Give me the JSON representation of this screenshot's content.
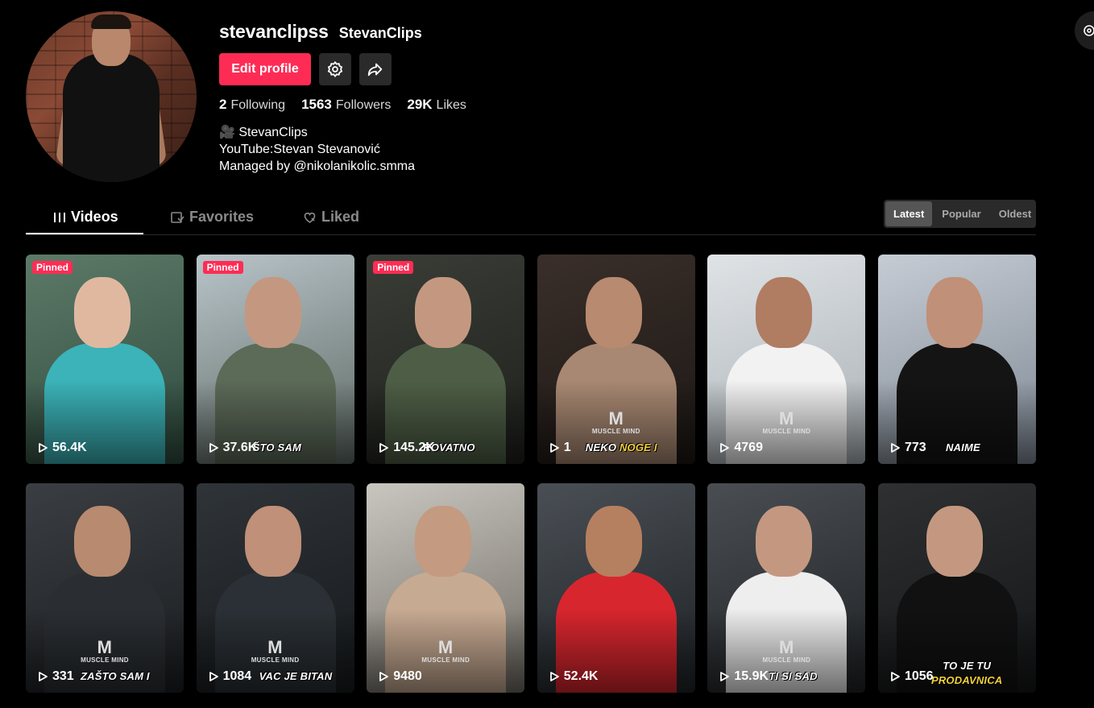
{
  "profile": {
    "username": "stevanclipss",
    "nickname": "StevanClips",
    "edit_label": "Edit profile",
    "stats": [
      {
        "value": "2",
        "label": "Following"
      },
      {
        "value": "1563",
        "label": "Followers"
      },
      {
        "value": "29K",
        "label": "Likes"
      }
    ],
    "bio": [
      "🎥 StevanClips",
      "YouTube:Stevan Stevanović",
      "Managed by @nikolanikolic.smma"
    ]
  },
  "tabs": [
    {
      "label": "Videos",
      "icon": "grid-icon"
    },
    {
      "label": "Favorites",
      "icon": "bookmark-icon"
    },
    {
      "label": "Liked",
      "icon": "heart-icon"
    }
  ],
  "sort": {
    "options": [
      "Latest",
      "Popular",
      "Oldest"
    ],
    "selected": "Latest"
  },
  "videos": [
    {
      "views": "56.4K",
      "pinned": "Pinned",
      "caption": "",
      "caption_hl": "",
      "brand": ""
    },
    {
      "views": "37.6K",
      "pinned": "Pinned",
      "caption": "ŠTO SAM",
      "caption_hl": "",
      "brand": ""
    },
    {
      "views": "145.2K",
      "pinned": "Pinned",
      "caption": "ROVATNO",
      "caption_hl": "",
      "brand": ""
    },
    {
      "views": "1",
      "pinned": "",
      "caption": "NEKO ",
      "caption_hl": "NOGE I",
      "brand": "MUSCLE MIND"
    },
    {
      "views": "4769",
      "pinned": "",
      "caption": "",
      "caption_hl": "",
      "brand": "MUSCLE MIND"
    },
    {
      "views": "773",
      "pinned": "",
      "caption": "NAIME",
      "caption_hl": "",
      "brand": ""
    },
    {
      "views": "331",
      "pinned": "",
      "caption": "ZAŠTO SAM I",
      "caption_hl": "",
      "brand": "MUSCLE MIND"
    },
    {
      "views": "1084",
      "pinned": "",
      "caption": "VAC JE BITAN",
      "caption_hl": "",
      "brand": "MUSCLE MIND"
    },
    {
      "views": "9480",
      "pinned": "",
      "caption": "",
      "caption_hl": "",
      "brand": "MUSCLE MIND"
    },
    {
      "views": "52.4K",
      "pinned": "",
      "caption": "",
      "caption_hl": "",
      "brand": ""
    },
    {
      "views": "15.9K",
      "pinned": "",
      "caption": "TI SI SAD",
      "caption_hl": "",
      "brand": "MUSCLE MIND"
    },
    {
      "views": "1056",
      "pinned": "",
      "caption": "TO JE TU",
      "caption_hl": "PRODAVNICA",
      "brand": ""
    }
  ],
  "colors": {
    "accent": "#fe2c55",
    "background": "#000000",
    "surface": "#2a2a2a"
  }
}
